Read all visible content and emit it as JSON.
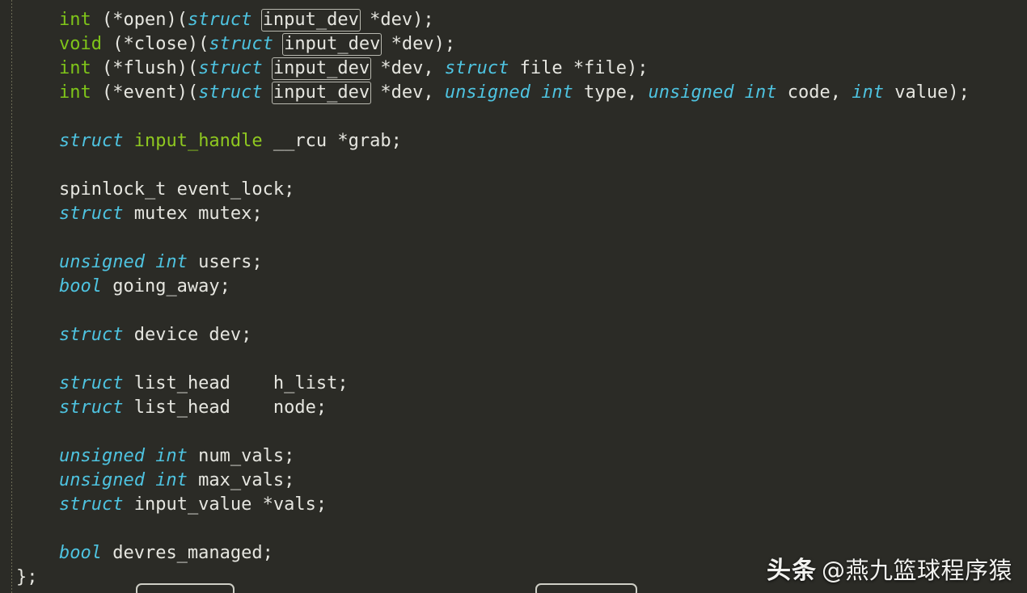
{
  "editor": {
    "language": "c",
    "theme_name": "dark",
    "colors": {
      "background": "#2b2b26",
      "foreground": "#e6e6e0",
      "type_keyword": "#7fc519",
      "storage_keyword": "#4ec3e0",
      "struct_name": "#8fc820",
      "occurrence_box_border": "#b9b9b0",
      "indent_guide": "#6b6a55"
    },
    "indent_guide_visible": true,
    "occurrence_highlight_token": "input_dev"
  },
  "code": {
    "lines": [
      {
        "id": "line-open",
        "tokens": [
          {
            "t": "    ",
            "k": "plain"
          },
          {
            "t": "int",
            "k": "type"
          },
          {
            "t": " (*open)(",
            "k": "plain"
          },
          {
            "t": "struct",
            "k": "kw"
          },
          {
            "t": " ",
            "k": "plain"
          },
          {
            "t": "input_dev",
            "k": "occ"
          },
          {
            "t": " *dev);",
            "k": "plain"
          }
        ]
      },
      {
        "id": "line-close",
        "tokens": [
          {
            "t": "    ",
            "k": "plain"
          },
          {
            "t": "void",
            "k": "type"
          },
          {
            "t": " (*close)(",
            "k": "plain"
          },
          {
            "t": "struct",
            "k": "kw"
          },
          {
            "t": " ",
            "k": "plain"
          },
          {
            "t": "input_dev",
            "k": "occ"
          },
          {
            "t": " *dev);",
            "k": "plain"
          }
        ]
      },
      {
        "id": "line-flush",
        "tokens": [
          {
            "t": "    ",
            "k": "plain"
          },
          {
            "t": "int",
            "k": "type"
          },
          {
            "t": " (*flush)(",
            "k": "plain"
          },
          {
            "t": "struct",
            "k": "kw"
          },
          {
            "t": " ",
            "k": "plain"
          },
          {
            "t": "input_dev",
            "k": "occ"
          },
          {
            "t": " *dev, ",
            "k": "plain"
          },
          {
            "t": "struct",
            "k": "kw"
          },
          {
            "t": " file *file);",
            "k": "plain"
          }
        ]
      },
      {
        "id": "line-event",
        "tokens": [
          {
            "t": "    ",
            "k": "plain"
          },
          {
            "t": "int",
            "k": "type"
          },
          {
            "t": " (*event)(",
            "k": "plain"
          },
          {
            "t": "struct",
            "k": "kw"
          },
          {
            "t": " ",
            "k": "plain"
          },
          {
            "t": "input_dev",
            "k": "occ"
          },
          {
            "t": " *dev, ",
            "k": "plain"
          },
          {
            "t": "unsigned int",
            "k": "kw"
          },
          {
            "t": " type, ",
            "k": "plain"
          },
          {
            "t": "unsigned int",
            "k": "kw"
          },
          {
            "t": " code, ",
            "k": "plain"
          },
          {
            "t": "int",
            "k": "kw"
          },
          {
            "t": " value);",
            "k": "plain"
          }
        ]
      },
      {
        "id": "line-blank-1",
        "tokens": []
      },
      {
        "id": "line-grab",
        "tokens": [
          {
            "t": "    ",
            "k": "plain"
          },
          {
            "t": "struct",
            "k": "kw"
          },
          {
            "t": " ",
            "k": "plain"
          },
          {
            "t": "input_handle",
            "k": "structname"
          },
          {
            "t": " __rcu *grab;",
            "k": "plain"
          }
        ]
      },
      {
        "id": "line-blank-2",
        "tokens": []
      },
      {
        "id": "line-event-lock",
        "tokens": [
          {
            "t": "    spinlock_t event_lock;",
            "k": "plain"
          }
        ]
      },
      {
        "id": "line-mutex",
        "tokens": [
          {
            "t": "    ",
            "k": "plain"
          },
          {
            "t": "struct",
            "k": "kw"
          },
          {
            "t": " mutex mutex;",
            "k": "plain"
          }
        ]
      },
      {
        "id": "line-blank-3",
        "tokens": []
      },
      {
        "id": "line-users",
        "tokens": [
          {
            "t": "    ",
            "k": "plain"
          },
          {
            "t": "unsigned int",
            "k": "kw"
          },
          {
            "t": " users;",
            "k": "plain"
          }
        ]
      },
      {
        "id": "line-going-away",
        "tokens": [
          {
            "t": "    ",
            "k": "plain"
          },
          {
            "t": "bool",
            "k": "kw"
          },
          {
            "t": " going_away;",
            "k": "plain"
          }
        ]
      },
      {
        "id": "line-blank-4",
        "tokens": []
      },
      {
        "id": "line-dev",
        "tokens": [
          {
            "t": "    ",
            "k": "plain"
          },
          {
            "t": "struct",
            "k": "kw"
          },
          {
            "t": " device dev;",
            "k": "plain"
          }
        ]
      },
      {
        "id": "line-blank-5",
        "tokens": []
      },
      {
        "id": "line-h-list",
        "tokens": [
          {
            "t": "    ",
            "k": "plain"
          },
          {
            "t": "struct",
            "k": "kw"
          },
          {
            "t": " list_head    h_list;",
            "k": "plain"
          }
        ]
      },
      {
        "id": "line-node",
        "tokens": [
          {
            "t": "    ",
            "k": "plain"
          },
          {
            "t": "struct",
            "k": "kw"
          },
          {
            "t": " list_head    node;",
            "k": "plain"
          }
        ]
      },
      {
        "id": "line-blank-6",
        "tokens": []
      },
      {
        "id": "line-num-vals",
        "tokens": [
          {
            "t": "    ",
            "k": "plain"
          },
          {
            "t": "unsigned int",
            "k": "kw"
          },
          {
            "t": " num_vals;",
            "k": "plain"
          }
        ]
      },
      {
        "id": "line-max-vals",
        "tokens": [
          {
            "t": "    ",
            "k": "plain"
          },
          {
            "t": "unsigned int",
            "k": "kw"
          },
          {
            "t": " max_vals;",
            "k": "plain"
          }
        ]
      },
      {
        "id": "line-vals",
        "tokens": [
          {
            "t": "    ",
            "k": "plain"
          },
          {
            "t": "struct",
            "k": "kw"
          },
          {
            "t": " input_value *vals;",
            "k": "plain"
          }
        ]
      },
      {
        "id": "line-blank-7",
        "tokens": []
      },
      {
        "id": "line-devres-managed",
        "tokens": [
          {
            "t": "    ",
            "k": "plain"
          },
          {
            "t": "bool",
            "k": "kw"
          },
          {
            "t": " devres_managed;",
            "k": "plain"
          }
        ]
      },
      {
        "id": "line-struct-close",
        "tokens": [
          {
            "t": "};",
            "k": "plain"
          }
        ]
      }
    ]
  },
  "bottom_widgets": [
    {
      "id": "bottom-chip-left",
      "label": ""
    },
    {
      "id": "bottom-chip-right",
      "label": ""
    }
  ],
  "watermark": {
    "brand": "头条",
    "handle": "@燕九篮球程序猿"
  }
}
